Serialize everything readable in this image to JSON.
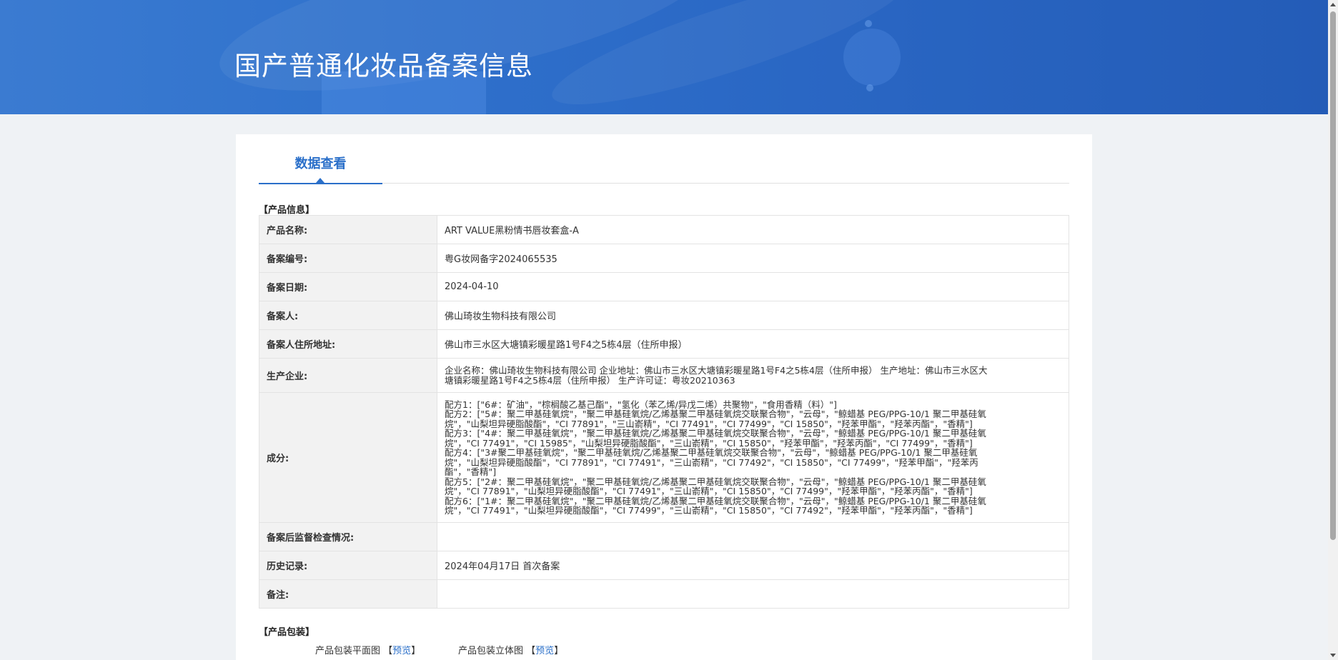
{
  "banner": {
    "title": "国产普通化妆品备案信息"
  },
  "tab": {
    "label": "数据查看"
  },
  "sections": {
    "product_info": "【产品信息】",
    "packaging": "【产品包装】"
  },
  "rows": [
    {
      "key": "产品名称:",
      "value": "ART VALUE黑粉情书唇妆套盒-A"
    },
    {
      "key": "备案编号:",
      "value": "粤G妆网备字2024065535"
    },
    {
      "key": "备案日期:",
      "value": "2024-04-10"
    },
    {
      "key": "备案人:",
      "value": "佛山琦妆生物科技有限公司"
    },
    {
      "key": "备案人住所地址:",
      "value": "佛山市三水区大塘镇彩暖星路1号F4之5栋4层（住所申报）"
    },
    {
      "key": "生产企业:",
      "value": "企业名称：佛山琦妆生物科技有限公司 企业地址：佛山市三水区大塘镇彩暖星路1号F4之5栋4层（住所申报） 生产地址：佛山市三水区大\n塘镇彩暖星路1号F4之5栋4层（住所申报） 生产许可证：粤妆20210363"
    },
    {
      "key": "成分:",
      "value": "配方1：[\"6#：矿油\"，\"棕榈酸乙基己酯\"，\"氢化（苯乙烯/异戊二烯）共聚物\"，\"食用香精（料）\"]\n配方2：[\"5#：聚二甲基硅氧烷\"，\"聚二甲基硅氧烷/乙烯基聚二甲基硅氧烷交联聚合物\"，\"云母\"，\"鲸蜡基 PEG/PPG-10/1 聚二甲基硅氧\n烷\"，\"山梨坦异硬脂酸酯\"，\"CI 77891\"，\"三山嵛精\"，\"CI 77491\"，\"CI 77499\"，\"CI 15850\"，\"羟苯甲酯\"，\"羟苯丙酯\"，\"香精\"]\n配方3：[\"4#：聚二甲基硅氧烷\"，\"聚二甲基硅氧烷/乙烯基聚二甲基硅氧烷交联聚合物\"，\"云母\"，\"鲸蜡基 PEG/PPG-10/1 聚二甲基硅氧\n烷\"，\"CI 77491\"，\"CI 15985\"，\"山梨坦异硬脂酸酯\"，\"三山嵛精\"，\"CI 15850\"，\"羟苯甲酯\"，\"羟苯丙酯\"，\"CI 77499\"，\"香精\"]\n配方4：[\"3#聚二甲基硅氧烷\"，\"聚二甲基硅氧烷/乙烯基聚二甲基硅氧烷交联聚合物\"，\"云母\"，\"鲸蜡基 PEG/PPG-10/1 聚二甲基硅氧\n烷\"，\"山梨坦异硬脂酸酯\"，\"CI 77891\"，\"CI 77491\"，\"三山嵛精\"，\"CI 77492\"，\"CI 15850\"，\"CI 77499\"，\"羟苯甲酯\"，\"羟苯丙\n酯\"，\"香精\"]\n配方5：[\"2#：聚二甲基硅氧烷\"，\"聚二甲基硅氧烷/乙烯基聚二甲基硅氧烷交联聚合物\"，\"云母\"，\"鲸蜡基 PEG/PPG-10/1 聚二甲基硅氧\n烷\"，\"CI 77891\"，\"山梨坦异硬脂酸酯\"，\"CI 77491\"，\"三山嵛精\"，\"CI 15850\"，\"CI 77499\"，\"羟苯甲酯\"，\"羟苯丙酯\"，\"香精\"]\n配方6：[\"1#：聚二甲基硅氧烷\"，\"聚二甲基硅氧烷/乙烯基聚二甲基硅氧烷交联聚合物\"，\"云母\"，\"鲸蜡基 PEG/PPG-10/1 聚二甲基硅氧\n烷\"，\"CI 77491\"，\"山梨坦异硬脂酸酯\"，\"CI 77499\"，\"三山嵛精\"，\"CI 15850\"，\"CI 77492\"，\"羟苯甲酯\"，\"羟苯丙酯\"，\"香精\"]"
    },
    {
      "key": "备案后监督检查情况:",
      "value": ""
    },
    {
      "key": "历史记录:",
      "value": "2024年04月17日 首次备案"
    },
    {
      "key": "备注:",
      "value": ""
    }
  ],
  "packaging": {
    "flat_label": "产品包装平面图",
    "solid_label": "产品包装立体图",
    "bracket_open": "【",
    "bracket_close": "】",
    "preview_label": "预览"
  }
}
